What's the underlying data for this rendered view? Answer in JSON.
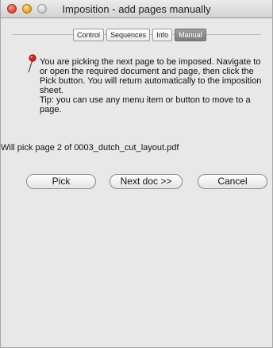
{
  "window": {
    "title": "Imposition - add pages manually"
  },
  "tabs": [
    {
      "label": "Control"
    },
    {
      "label": "Sequences"
    },
    {
      "label": "Info"
    },
    {
      "label": "Manual",
      "selected": true
    }
  ],
  "message": {
    "icon": "push-pin-icon",
    "instruction": "You are picking the next page to be imposed. Navigate to or open the required document and page, then click the Pick button. You will return automatically to the imposition sheet.",
    "tip": "Tip: you can use any menu item or button to move to a page."
  },
  "status": "Will pick page 2 of 0003_dutch_cut_layout.pdf",
  "buttons": {
    "pick": "Pick",
    "next_doc": "Next doc >>",
    "cancel": "Cancel"
  }
}
